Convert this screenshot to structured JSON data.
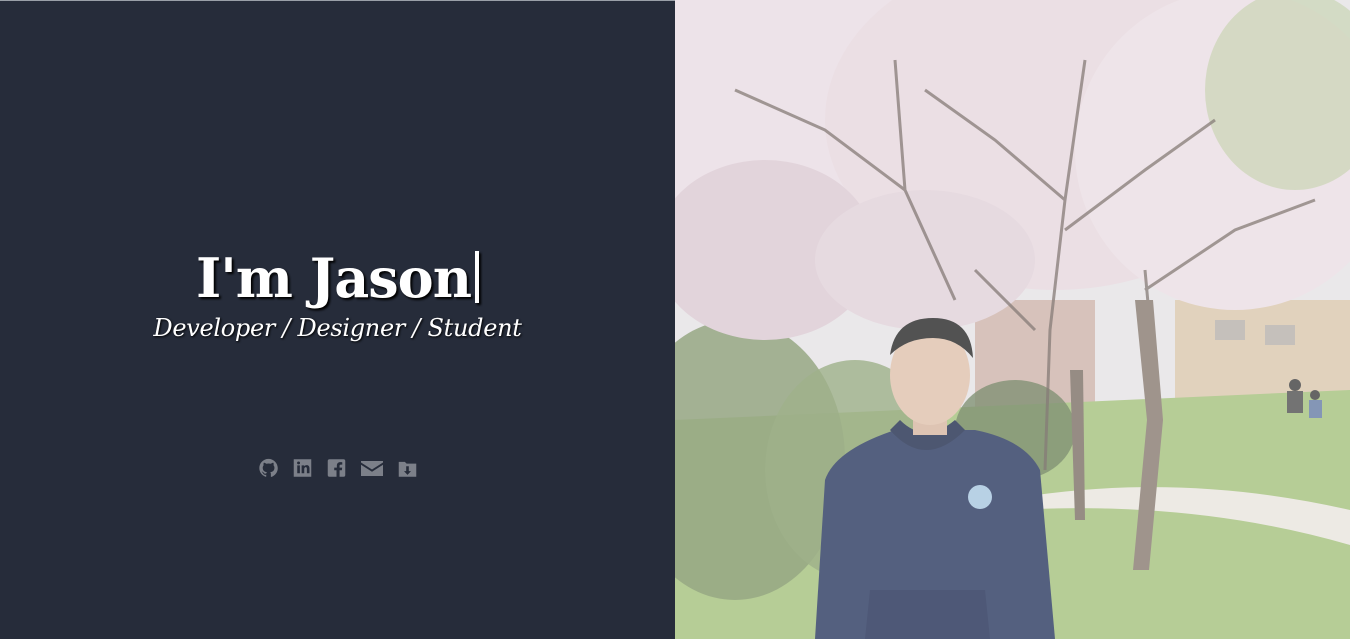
{
  "hero": {
    "title": "I'm Jason",
    "subtitle": "Developer / Designer / Student"
  },
  "social": [
    {
      "name": "github-icon",
      "label": "GitHub"
    },
    {
      "name": "linkedin-icon",
      "label": "LinkedIn"
    },
    {
      "name": "facebook-icon",
      "label": "Facebook"
    },
    {
      "name": "email-icon",
      "label": "Email"
    },
    {
      "name": "download-icon",
      "label": "Download"
    }
  ],
  "colors": {
    "left_background": "#262c3a",
    "text": "#ffffff",
    "icon": "#7c8089"
  },
  "photo": {
    "subject": "portrait-photo",
    "description_icon": "photo"
  }
}
